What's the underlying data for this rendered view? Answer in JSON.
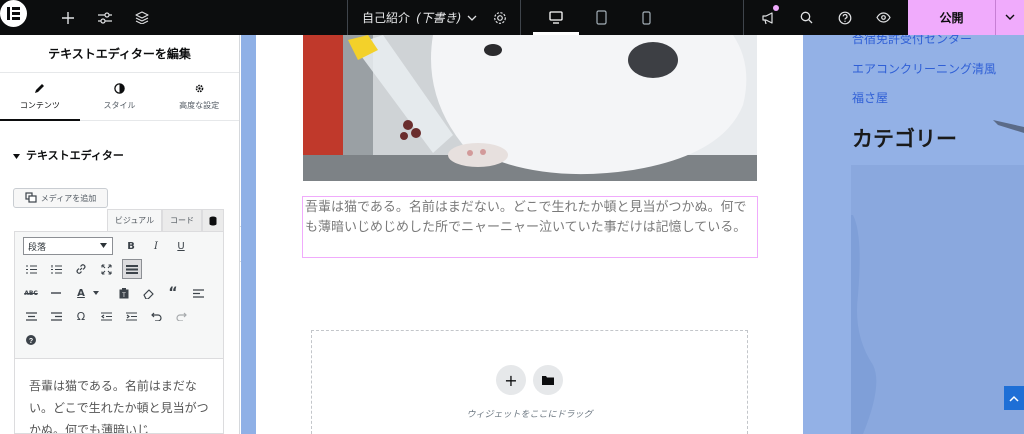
{
  "topbar": {
    "page_title": "自己紹介",
    "page_status": "(下書き)",
    "publish_label": "公開"
  },
  "panel": {
    "header": "テキストエディターを編集",
    "tabs": [
      {
        "label": "コンテンツ",
        "icon": "pencil-icon"
      },
      {
        "label": "スタイル",
        "icon": "half-circle-icon"
      },
      {
        "label": "高度な設定",
        "icon": "gear-icon"
      }
    ],
    "section_title": "テキストエディター",
    "add_media_label": "メディアを追加",
    "mode_tabs": {
      "visual": "ビジュアル",
      "code": "コード"
    },
    "format_select": "段落",
    "toolbar_letters": {
      "bold": "B",
      "italic": "I",
      "underline": "U",
      "text_color": "A",
      "abc": "ABC",
      "omega": "Ω"
    },
    "editor_text": "吾輩は猫である。名前はまだない。どこで生れたか頓と見当がつかぬ。何でも薄暗いじ"
  },
  "canvas": {
    "text_widget": "吾輩は猫である。名前はまだない。どこで生れたか頓と見当がつかぬ。何でも薄暗いじめじめした所でニャーニャー泣いていた事だけは記憶している。",
    "drop_label": "ウィジェットをここにドラッグ"
  },
  "sidebar": {
    "links": [
      "合宿免許受付センター",
      "エアコンクリーニング清風",
      "福さ屋"
    ],
    "heading": "カテゴリー"
  },
  "colors": {
    "accent": "#f0abfc",
    "topbar": "#0c0d0e",
    "canvas_bg": "#8fb0e6",
    "link": "#2f5fd6"
  }
}
